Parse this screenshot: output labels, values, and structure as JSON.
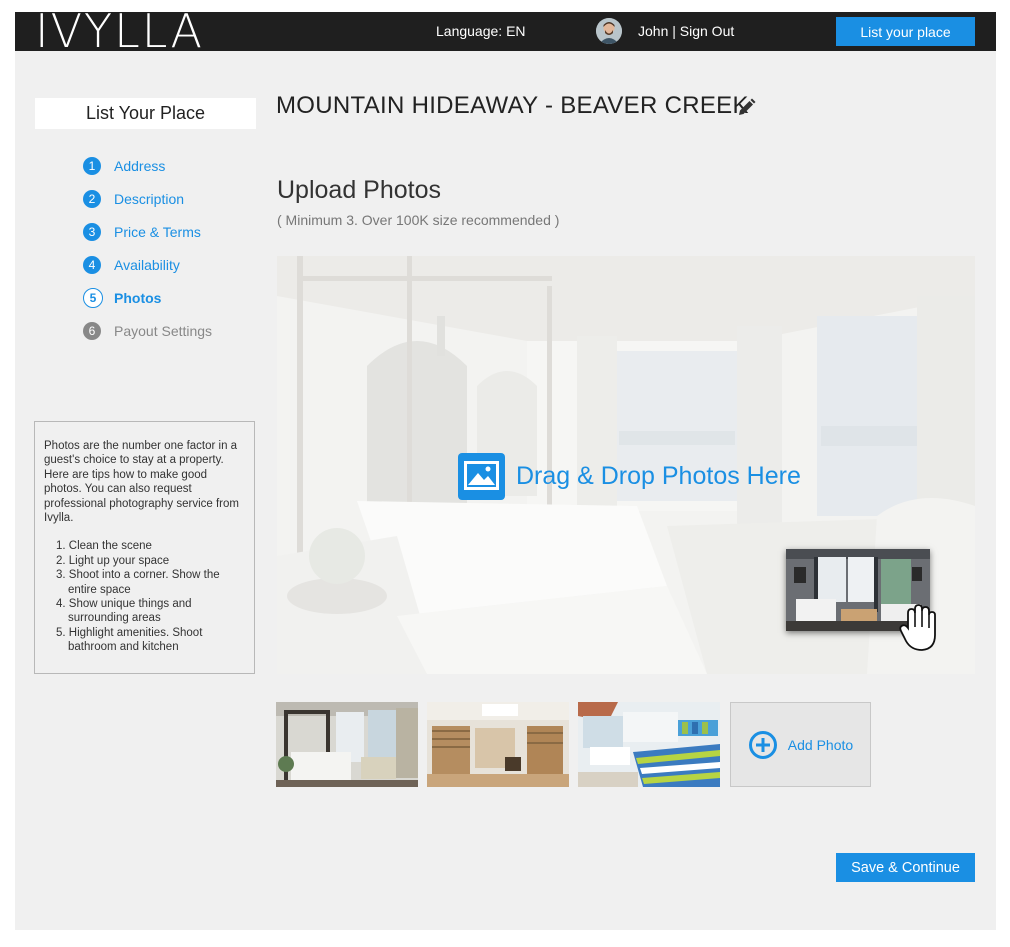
{
  "header": {
    "logo": "IVYLLA",
    "language": "Language: EN",
    "user": "John | Sign Out",
    "list_button": "List your place"
  },
  "sidebar": {
    "title": "List Your Place",
    "steps": [
      {
        "num": "1",
        "label": "Address"
      },
      {
        "num": "2",
        "label": "Description"
      },
      {
        "num": "3",
        "label": "Price & Terms"
      },
      {
        "num": "4",
        "label": "Availability"
      },
      {
        "num": "5",
        "label": "Photos"
      },
      {
        "num": "6",
        "label": "Payout Settings"
      }
    ],
    "tips": {
      "intro": "Photos are the number one factor in a guest's choice to stay at a property. Here are tips how to make good photos. You can also request professional photography service from Ivylla.",
      "items": [
        "1. Clean the scene",
        "2. Light up your space",
        "3. Shoot into a corner. Show the entire space",
        "4. Show unique things and surrounding areas",
        "5. Highlight amenities. Shoot bathroom and kitchen"
      ]
    }
  },
  "main": {
    "title": "MOUNTAIN HIDEAWAY - BEAVER CREEK",
    "upload_heading": "Upload Photos",
    "upload_sub": "( Minimum 3.  Over 100K size recommended )",
    "drop_label": "Drag & Drop Photos Here",
    "add_photo": "Add Photo",
    "save_button": "Save & Continue"
  },
  "colors": {
    "accent": "#1a8fe3",
    "topbar": "#1f1f1f",
    "background": "#f0f0f0"
  }
}
